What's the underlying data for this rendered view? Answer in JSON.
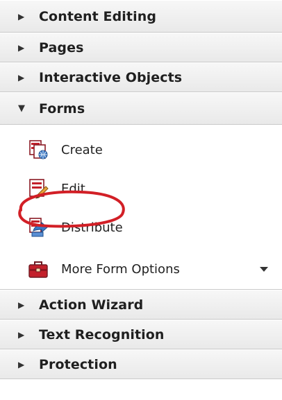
{
  "panel": {
    "sections_top": [
      {
        "label": "Content Editing",
        "expanded": false
      },
      {
        "label": "Pages",
        "expanded": false
      },
      {
        "label": "Interactive Objects",
        "expanded": false
      }
    ],
    "forms": {
      "label": "Forms",
      "expanded": true,
      "items": [
        {
          "label": "Create",
          "icon": "form-create-icon"
        },
        {
          "label": "Edit",
          "icon": "form-edit-icon",
          "highlighted": true
        },
        {
          "label": "Distribute",
          "icon": "form-distribute-icon"
        },
        {
          "label": "More Form Options",
          "icon": "toolbox-icon",
          "has_dropdown": true
        }
      ]
    },
    "sections_bottom": [
      {
        "label": "Action Wizard",
        "expanded": false
      },
      {
        "label": "Text Recognition",
        "expanded": false
      },
      {
        "label": "Protection",
        "expanded": false
      }
    ]
  },
  "colors": {
    "highlight": "#d21f26",
    "header_bg": "#eeeeee",
    "border": "#c9c9c9"
  }
}
